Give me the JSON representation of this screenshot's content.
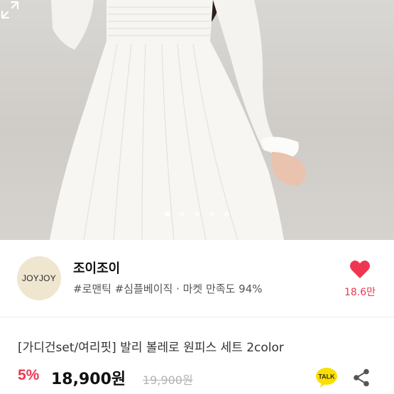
{
  "gallery": {
    "image_alt": "white smocked long-sleeve maxi dress on model",
    "slide_count": 5,
    "active_slide": 1,
    "expand_icon": "expand-icon"
  },
  "shop": {
    "logo_text": "JOYJOY",
    "name": "조이조이",
    "tags": "#로맨틱 #심플베이직 · 마켓 만족도 94%",
    "like_icon": "heart-icon",
    "like_count": "18.6만"
  },
  "product": {
    "title": "[가디건set/여리핏] 발리 볼레로 원피스 세트 2color",
    "discount": "5%",
    "price": "18,900원",
    "original_price": "19,900원",
    "talk_label": "TALK",
    "share_icon": "share-icon"
  },
  "colors": {
    "accent": "#ee3653",
    "talk_bg": "#f9e000"
  }
}
